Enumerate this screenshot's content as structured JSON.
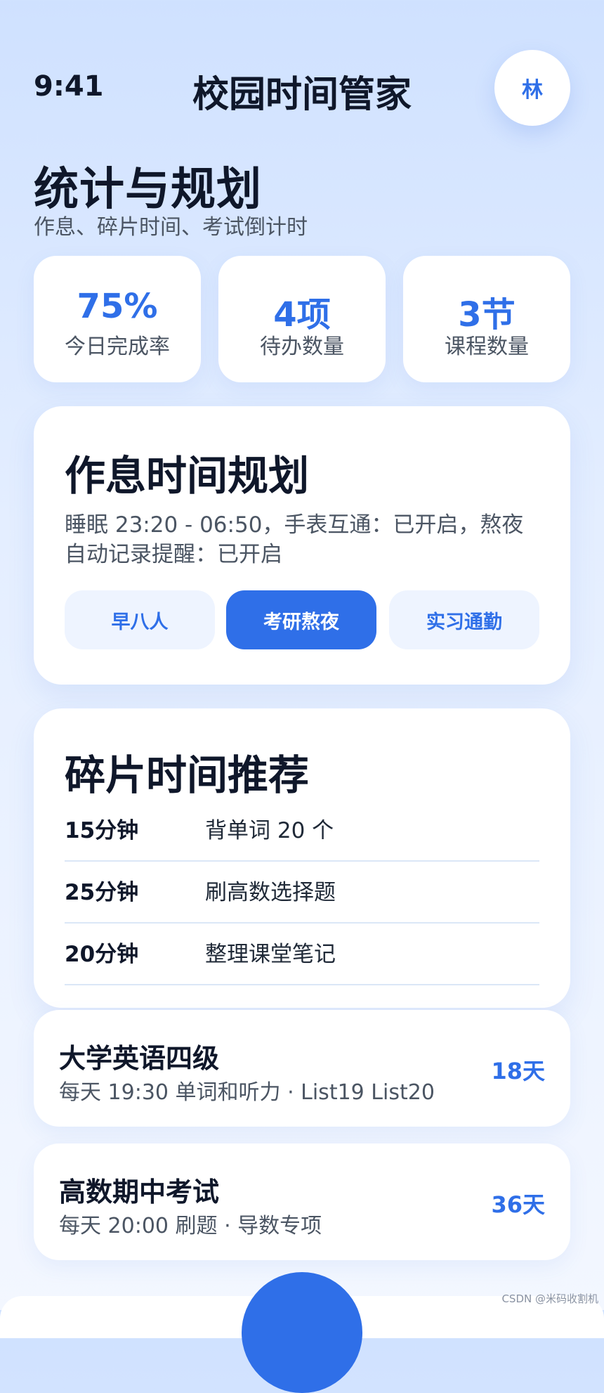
{
  "status_bar": {
    "time": "9:41"
  },
  "header": {
    "title": "校园时间管家",
    "avatar_initial": "林"
  },
  "page": {
    "title": "统计与规划",
    "subtitle": "作息、碎片时间、考试倒计时"
  },
  "stats": [
    {
      "value": "75%",
      "label": "今日完成率"
    },
    {
      "value": "4项",
      "label": "待办数量"
    },
    {
      "value": "3节",
      "label": "课程数量"
    }
  ],
  "schedule": {
    "title": "作息时间规划",
    "description": "睡眠 23:20 - 06:50，手表互通：已开启，熬夜自动记录提醒：已开启",
    "modes": [
      {
        "label": "早八人",
        "active": false
      },
      {
        "label": "考研熬夜",
        "active": true
      },
      {
        "label": "实习通勤",
        "active": false
      }
    ]
  },
  "fragments": {
    "title": "碎片时间推荐",
    "items": [
      {
        "duration": "15分钟",
        "task": "背单词 20 个"
      },
      {
        "duration": "25分钟",
        "task": "刷高数选择题"
      },
      {
        "duration": "20分钟",
        "task": "整理课堂笔记"
      }
    ]
  },
  "exams": [
    {
      "name": "大学英语四级",
      "detail": "每天 19:30 单词和听力 · List19 List20",
      "days": "18天"
    },
    {
      "name": "高数期中考试",
      "detail": "每天 20:00 刷题 · 导数专项",
      "days": "36天"
    }
  ],
  "watermark": "CSDN @米码收割机",
  "colors": {
    "accent": "#2f6fe8",
    "background_top": "#cfe1ff",
    "card": "#ffffff"
  }
}
